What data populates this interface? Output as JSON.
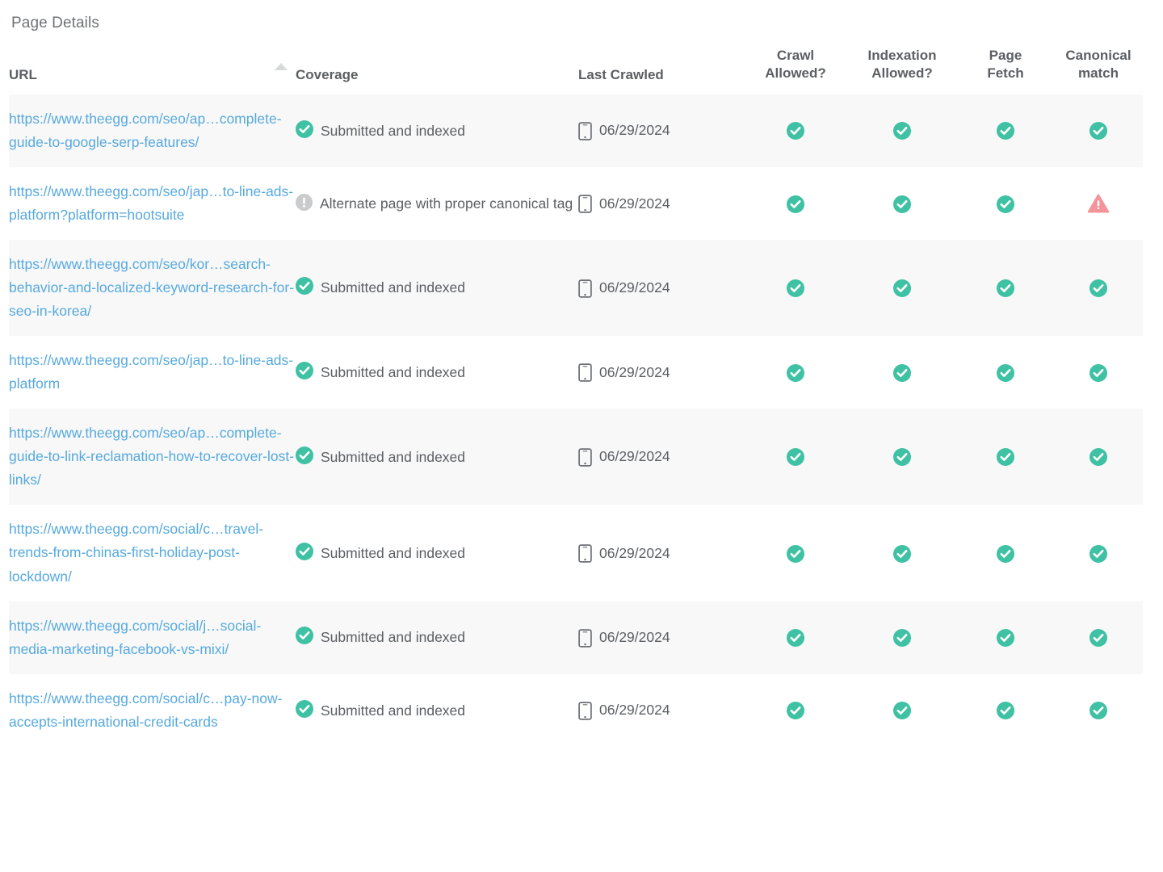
{
  "page": {
    "title": "Page Details"
  },
  "table": {
    "columns": [
      {
        "key": "url",
        "label": "URL",
        "sort": "ascending",
        "sort_icon": "triangle-up-icon"
      },
      {
        "key": "coverage",
        "label": "Coverage"
      },
      {
        "key": "last_crawled",
        "label": "Last Crawled"
      },
      {
        "key": "crawl_allowed",
        "label_line1": "Crawl",
        "label_line2": "Allowed?"
      },
      {
        "key": "indexation_allowed",
        "label_line1": "Indexation",
        "label_line2": "Allowed?"
      },
      {
        "key": "page_fetch",
        "label_line1": "Page",
        "label_line2": "Fetch"
      },
      {
        "key": "canonical_match",
        "label_line1": "Canonical",
        "label_line2": "match"
      }
    ],
    "rows": [
      {
        "url": "https://www.theegg.com/seo/ap…complete-guide-to-google-serp-features/",
        "coverage": "Submitted and indexed",
        "coverage_icon": "check-circle-icon",
        "last_crawled": "06/29/2024",
        "device_icon": "mobile-icon",
        "crawl_allowed": "check-circle-icon",
        "indexation_allowed": "check-circle-icon",
        "page_fetch": "check-circle-icon",
        "canonical_match": "check-circle-icon"
      },
      {
        "url": "https://www.theegg.com/seo/jap…to-line-ads-platform?platform=hootsuite",
        "coverage": "Alternate page with proper canonical tag",
        "coverage_icon": "info-circle-icon",
        "last_crawled": "06/29/2024",
        "device_icon": "mobile-icon",
        "crawl_allowed": "check-circle-icon",
        "indexation_allowed": "check-circle-icon",
        "page_fetch": "check-circle-icon",
        "canonical_match": "warning-triangle-icon"
      },
      {
        "url": "https://www.theegg.com/seo/kor…search-behavior-and-localized-keyword-research-for-seo-in-korea/",
        "coverage": "Submitted and indexed",
        "coverage_icon": "check-circle-icon",
        "last_crawled": "06/29/2024",
        "device_icon": "mobile-icon",
        "crawl_allowed": "check-circle-icon",
        "indexation_allowed": "check-circle-icon",
        "page_fetch": "check-circle-icon",
        "canonical_match": "check-circle-icon"
      },
      {
        "url": "https://www.theegg.com/seo/jap…to-line-ads-platform",
        "coverage": "Submitted and indexed",
        "coverage_icon": "check-circle-icon",
        "last_crawled": "06/29/2024",
        "device_icon": "mobile-icon",
        "crawl_allowed": "check-circle-icon",
        "indexation_allowed": "check-circle-icon",
        "page_fetch": "check-circle-icon",
        "canonical_match": "check-circle-icon"
      },
      {
        "url": "https://www.theegg.com/seo/ap…complete-guide-to-link-reclamation-how-to-recover-lost-links/",
        "coverage": "Submitted and indexed",
        "coverage_icon": "check-circle-icon",
        "last_crawled": "06/29/2024",
        "device_icon": "mobile-icon",
        "crawl_allowed": "check-circle-icon",
        "indexation_allowed": "check-circle-icon",
        "page_fetch": "check-circle-icon",
        "canonical_match": "check-circle-icon"
      },
      {
        "url": "https://www.theegg.com/social/c…travel-trends-from-chinas-first-holiday-post-lockdown/",
        "coverage": "Submitted and indexed",
        "coverage_icon": "check-circle-icon",
        "last_crawled": "06/29/2024",
        "device_icon": "mobile-icon",
        "crawl_allowed": "check-circle-icon",
        "indexation_allowed": "check-circle-icon",
        "page_fetch": "check-circle-icon",
        "canonical_match": "check-circle-icon"
      },
      {
        "url": "https://www.theegg.com/social/j…social-media-marketing-facebook-vs-mixi/",
        "coverage": "Submitted and indexed",
        "coverage_icon": "check-circle-icon",
        "last_crawled": "06/29/2024",
        "device_icon": "mobile-icon",
        "crawl_allowed": "check-circle-icon",
        "indexation_allowed": "check-circle-icon",
        "page_fetch": "check-circle-icon",
        "canonical_match": "check-circle-icon"
      },
      {
        "url": "https://www.theegg.com/social/c…pay-now-accepts-international-credit-cards",
        "coverage": "Submitted and indexed",
        "coverage_icon": "check-circle-icon",
        "last_crawled": "06/29/2024",
        "device_icon": "mobile-icon",
        "crawl_allowed": "check-circle-icon",
        "indexation_allowed": "check-circle-icon",
        "page_fetch": "check-circle-icon",
        "canonical_match": "check-circle-icon"
      }
    ]
  },
  "colors": {
    "link": "#56a9de",
    "text": "#5b5f63",
    "header_text": "#5b5f63",
    "success": "#3fc1a3",
    "info": "#c9cbcc",
    "warning": "#f4949a",
    "row_alt_bg": "#f8f8f8",
    "row_bg": "#ffffff"
  }
}
